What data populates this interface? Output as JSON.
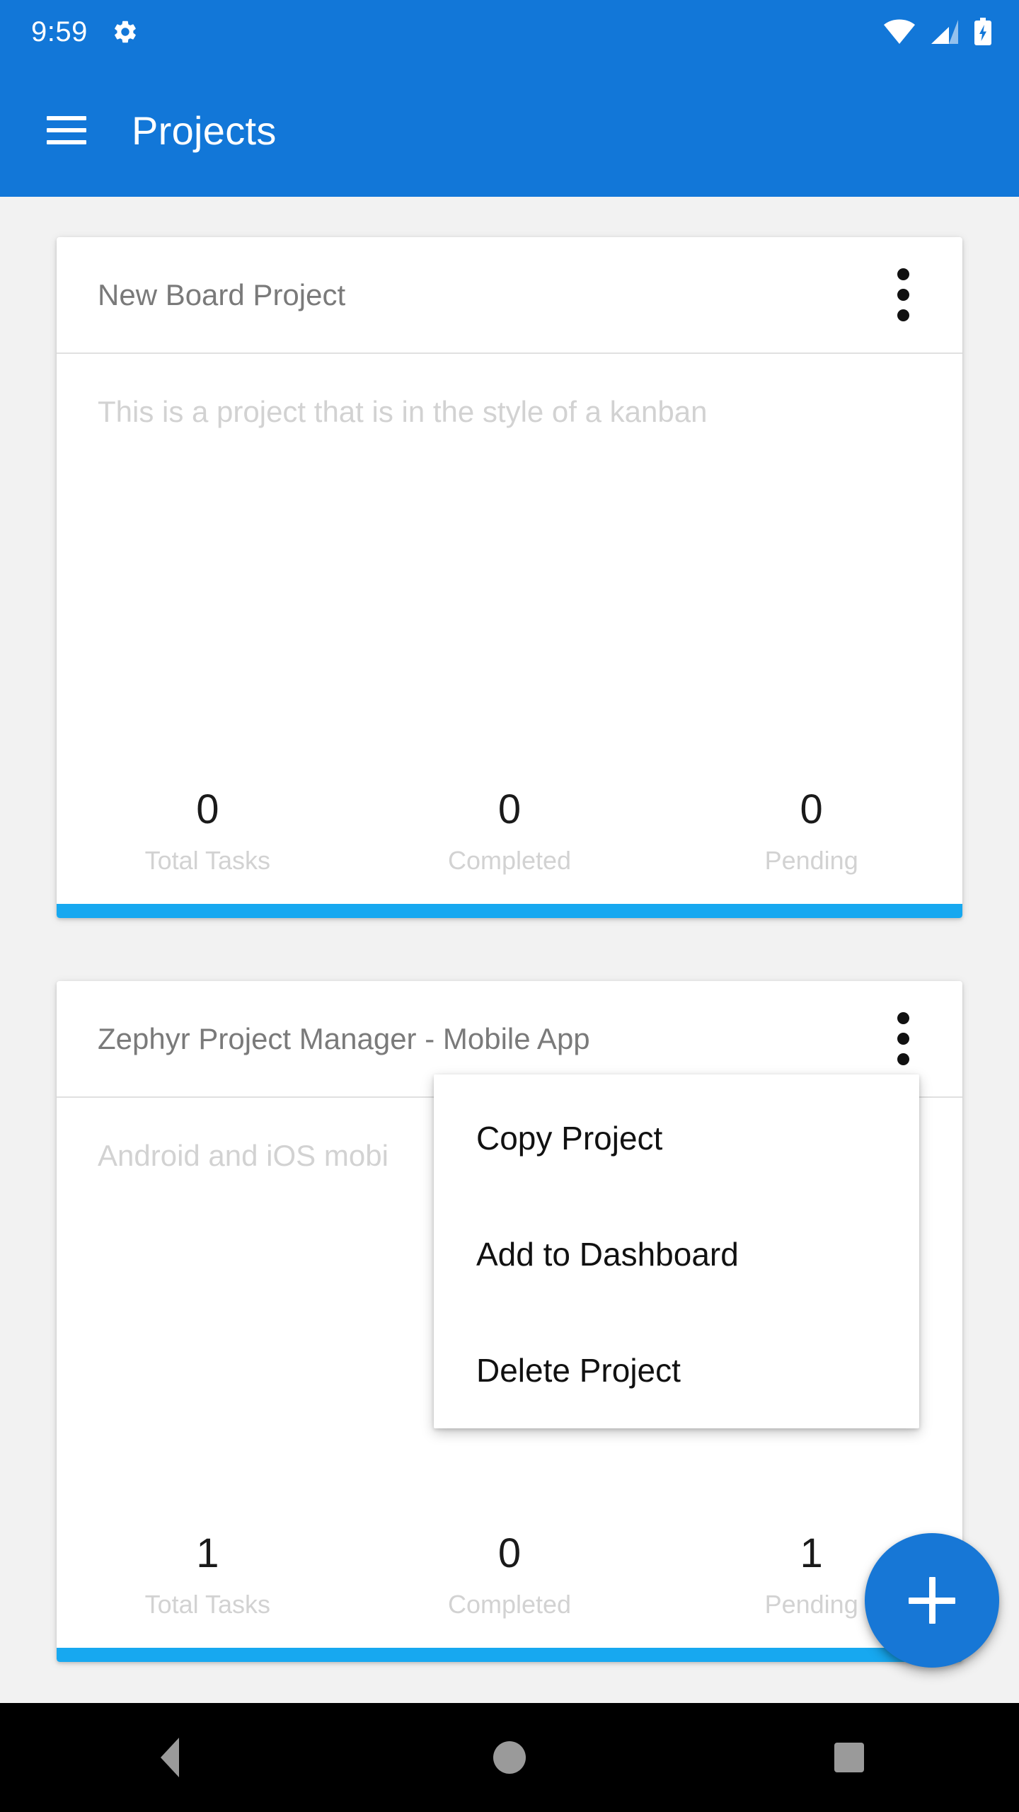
{
  "status_bar": {
    "time": "9:59",
    "gear_icon": "gear-icon",
    "wifi_icon": "wifi-icon",
    "cellular_icon": "cellular-signal-icon",
    "battery_icon": "battery-charging-icon"
  },
  "app_bar": {
    "menu_icon": "hamburger-menu-icon",
    "title": "Projects",
    "background_color": "#1277d8"
  },
  "projects": [
    {
      "title": "New Board Project",
      "description": "This is a project that is in the style of a kanban",
      "overflow_icon": "more-vertical-icon",
      "stats": [
        {
          "value": "0",
          "label": "Total Tasks"
        },
        {
          "value": "0",
          "label": "Completed"
        },
        {
          "value": "0",
          "label": "Pending"
        }
      ],
      "progress_percent": 100,
      "progress_color": "#17a8f0"
    },
    {
      "title": "Zephyr Project Manager - Mobile App",
      "description": "Android and iOS mobi",
      "overflow_icon": "more-vertical-icon",
      "stats": [
        {
          "value": "1",
          "label": "Total Tasks"
        },
        {
          "value": "0",
          "label": "Completed"
        },
        {
          "value": "1",
          "label": "Pending"
        }
      ],
      "progress_percent": 100,
      "progress_color": "#17a8f0"
    }
  ],
  "popup_menu": {
    "items": [
      {
        "label": "Copy Project"
      },
      {
        "label": "Add to Dashboard"
      },
      {
        "label": "Delete Project"
      }
    ]
  },
  "fab": {
    "icon": "plus-icon",
    "color": "#1777d6"
  },
  "nav_bar": {
    "back_icon": "back-triangle-icon",
    "home_icon": "home-circle-icon",
    "recents_icon": "recents-square-icon"
  }
}
